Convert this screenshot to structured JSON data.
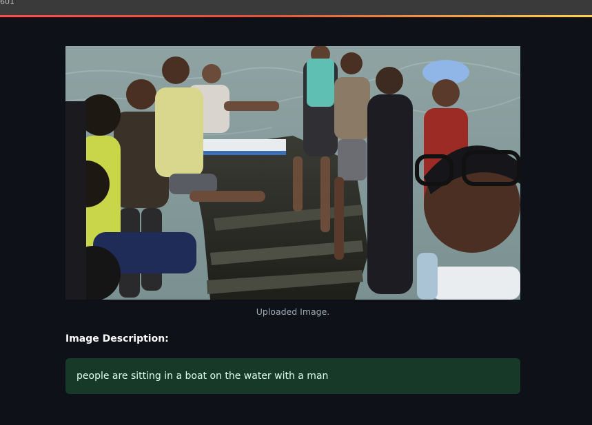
{
  "window": {
    "title_fragment": "601"
  },
  "image": {
    "alt": "Uploaded Image.",
    "caption": "Uploaded Image."
  },
  "description": {
    "heading": "Image Description:",
    "text": "people are sitting in a boat on the water with a man"
  },
  "colors": {
    "background": "#0e1117",
    "success_bg": "#173928",
    "success_text": "#dffde9",
    "caption_text": "#a3a8b8",
    "accent_gradient_start": "#ff4b4b",
    "accent_gradient_end": "#ffd24a"
  }
}
